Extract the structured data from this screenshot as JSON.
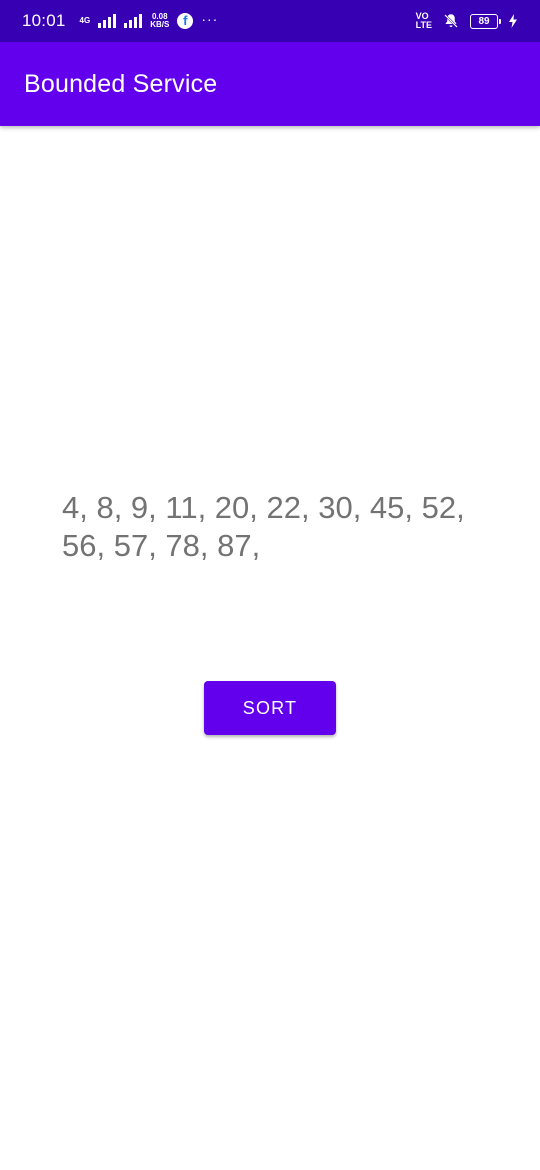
{
  "status_bar": {
    "time": "10:01",
    "network_type": "4G",
    "data_rate_value": "0.08",
    "data_rate_unit": "KB/S",
    "notification_more": "···",
    "volte_top": "VO",
    "volte_bottom": "LTE",
    "battery_level": "89",
    "icons": [
      "signal-icon",
      "facebook-icon",
      "volte-icon",
      "muted-bell-icon",
      "battery-icon",
      "charging-icon"
    ]
  },
  "app_bar": {
    "title": "Bounded Service"
  },
  "main": {
    "sorted_numbers": "4, 8, 9, 11, 20, 22, 30, 45, 52, 56, 57, 78, 87,",
    "sort_button_label": "SORT"
  },
  "colors": {
    "status_bar": "#3700b3",
    "primary": "#6200ee",
    "text_secondary": "#737373",
    "background": "#ffffff"
  }
}
